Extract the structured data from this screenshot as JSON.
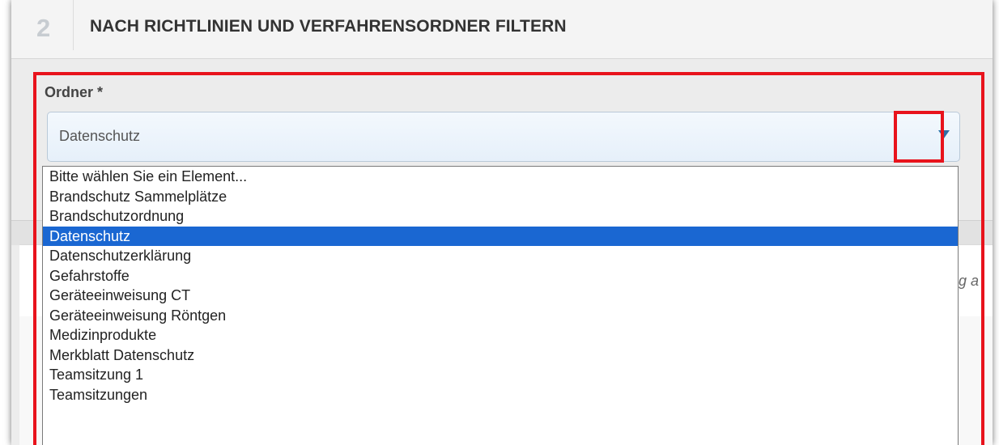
{
  "header": {
    "step_number": "2",
    "title": "NACH RICHTLINIEN UND VERFAHRENSORDNER FILTERN"
  },
  "field": {
    "label": "Ordner *",
    "selected_value": "Datenschutz"
  },
  "dropdown": {
    "options": [
      "Bitte wählen Sie ein Element...",
      "Brandschutz Sammelplätze",
      "Brandschutzordnung",
      "Datenschutz",
      "Datenschutzerklärung",
      "Gefahrstoffe",
      "Geräteeinweisung CT",
      "Geräteeinweisung Röntgen",
      "Medizinprodukte",
      "Merkblatt Datenschutz",
      "Teamsitzung 1",
      "Teamsitzungen"
    ],
    "selected_index": 3
  },
  "background": {
    "partial_text": "ißg a"
  },
  "colors": {
    "highlight": "#e8131c",
    "selection": "#1a67d2",
    "arrow": "#2f6ea3"
  }
}
